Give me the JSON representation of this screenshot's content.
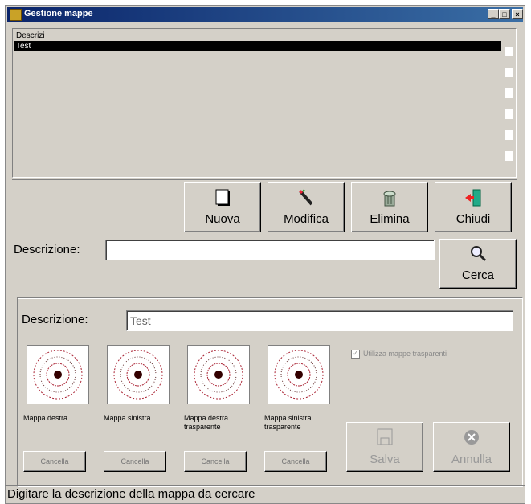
{
  "window": {
    "title": "Gestione mappe"
  },
  "titlebar_buttons": {
    "minimize": "_",
    "maximize": "□",
    "close": "×"
  },
  "list": {
    "items": [
      {
        "label": "Descrizi"
      },
      {
        "label": "Test"
      }
    ]
  },
  "toolbar": {
    "new_label": "Nuova",
    "edit_label": "Modifica",
    "delete_label": "Elimina",
    "close_label": "Chiudi"
  },
  "search": {
    "label": "Descrizione:",
    "value": "",
    "button_label": "Cerca"
  },
  "detail": {
    "label": "Descrizione:",
    "value": "Test",
    "checkbox_label": "Utilizza mappe trasparenti",
    "maps": [
      {
        "caption": "Mappa destra",
        "clear_label": "Cancella"
      },
      {
        "caption": "Mappa sinistra",
        "clear_label": "Cancella"
      },
      {
        "caption": "Mappa destra trasparente",
        "clear_label": "Cancella"
      },
      {
        "caption": "Mappa sinistra trasparente",
        "clear_label": "Cancella"
      }
    ],
    "save_label": "Salva",
    "cancel_label": "Annulla"
  },
  "status": {
    "text": "Digitare la descrizione della mappa da cercare"
  }
}
